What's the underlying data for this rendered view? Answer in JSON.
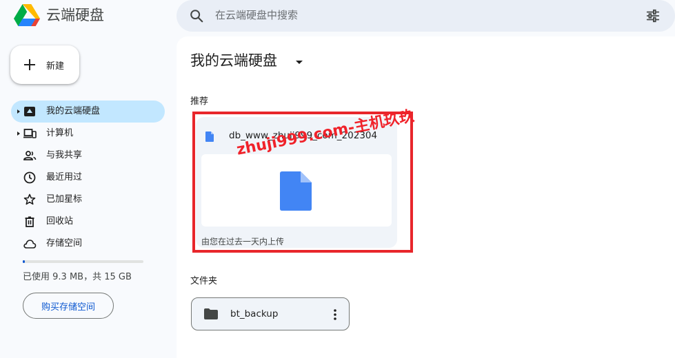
{
  "app": {
    "title": "云端硬盘"
  },
  "search": {
    "placeholder": "在云端硬盘中搜索"
  },
  "new_button": {
    "label": "新建"
  },
  "sidebar": {
    "items": [
      {
        "label": "我的云端硬盘",
        "icon": "my-drive-icon",
        "active": true,
        "expandable": true
      },
      {
        "label": "计算机",
        "icon": "computers-icon",
        "active": false,
        "expandable": true
      },
      {
        "label": "与我共享",
        "icon": "shared-with-me-icon",
        "active": false,
        "expandable": false
      },
      {
        "label": "最近用过",
        "icon": "recent-icon",
        "active": false,
        "expandable": false
      },
      {
        "label": "已加星标",
        "icon": "star-icon",
        "active": false,
        "expandable": false
      },
      {
        "label": "回收站",
        "icon": "trash-icon",
        "active": false,
        "expandable": false
      },
      {
        "label": "存储空间",
        "icon": "cloud-icon",
        "active": false,
        "expandable": false
      }
    ],
    "storage": {
      "text": "已使用 9.3 MB，共 15 GB",
      "used_fraction": 0.015
    },
    "buy_storage_label": "购买存储空间"
  },
  "main": {
    "title": "我的云端硬盘",
    "suggested_label": "推荐",
    "suggested_file": {
      "name": "db_www_zhuji999_com_202304",
      "reason": "由您在过去一天内上传"
    },
    "folders_label": "文件夹",
    "folders": [
      {
        "name": "bt_backup"
      }
    ],
    "watermark": "zhuji999.com-主机玖玖"
  },
  "colors": {
    "accent": "#0b57d0",
    "active_nav": "#c2e7ff",
    "highlight": "#e8262b",
    "doc_blue": "#4285f4"
  }
}
